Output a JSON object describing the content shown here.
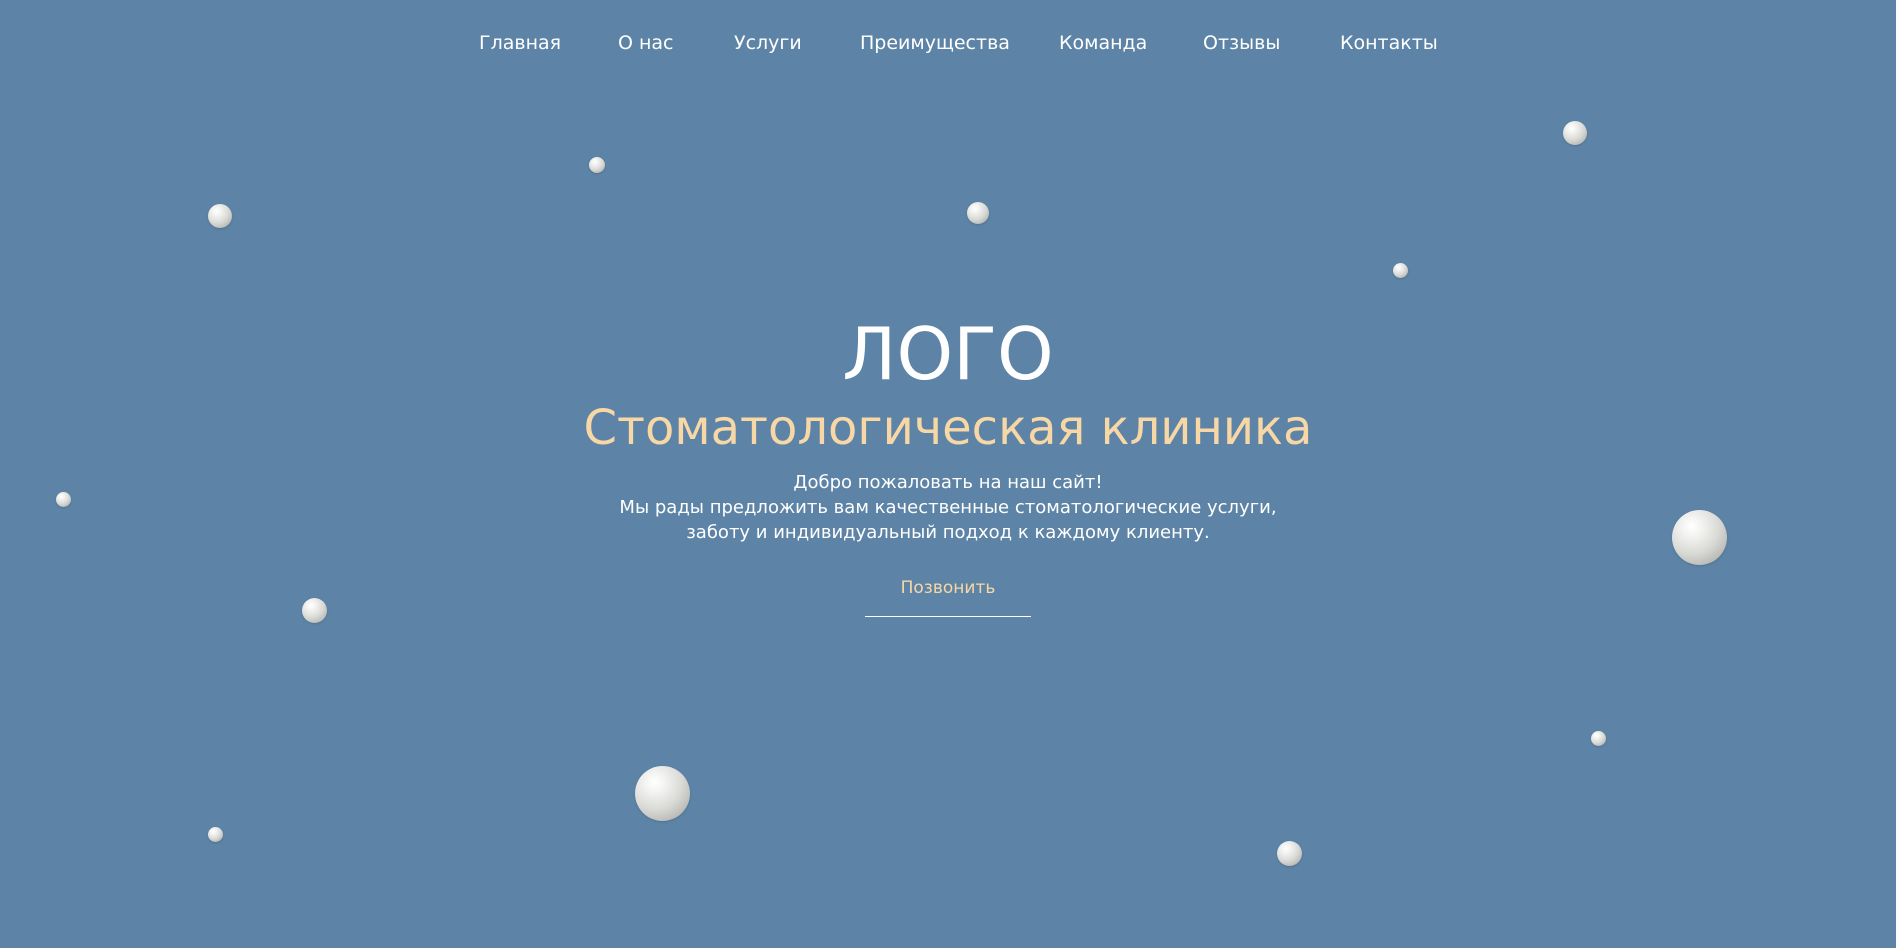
{
  "nav": {
    "items": [
      {
        "label": "Главная"
      },
      {
        "label": "О нас"
      },
      {
        "label": "Услуги"
      },
      {
        "label": "Преимущества"
      },
      {
        "label": "Команда"
      },
      {
        "label": "Отзывы"
      },
      {
        "label": "Контакты"
      }
    ]
  },
  "hero": {
    "logo": "ЛОГО",
    "subtitle": "Стоматологическая клиника",
    "welcome_line1": "Добро пожаловать на наш сайт!",
    "welcome_line2": "Мы рады предложить вам качественные стоматологические услуги, заботу и индивидуальный подход к каждому клиенту.",
    "call_button": "Позвонить"
  },
  "colors": {
    "background": "#5d84a6",
    "accent": "#f8d7a6",
    "text": "#ffffff"
  },
  "decorations": {
    "pearl_icon": "pearl-icon"
  }
}
